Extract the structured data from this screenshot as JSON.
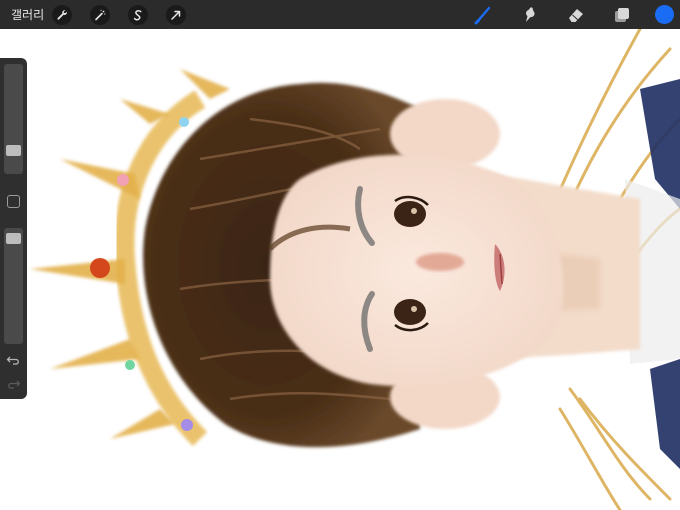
{
  "app": {
    "gallery_label": "갤러리"
  },
  "toolbar_left": [
    {
      "name": "actions-wrench-icon"
    },
    {
      "name": "adjustments-wand-icon"
    },
    {
      "name": "selection-s-icon"
    },
    {
      "name": "transform-arrow-icon"
    }
  ],
  "toolbar_right": [
    {
      "name": "brush-icon",
      "active": true
    },
    {
      "name": "smudge-icon",
      "active": false
    },
    {
      "name": "eraser-icon",
      "active": false
    },
    {
      "name": "layers-icon",
      "active": false
    }
  ],
  "colors": {
    "accent": "#1a6cf5",
    "current_color": "#1a6cf5",
    "toolbar_bg": "#2b2b2b",
    "sidebar_bg": "#2f2f2f"
  },
  "sidebar": {
    "brush_size_level": 0.82,
    "opacity_level": 0.05
  }
}
